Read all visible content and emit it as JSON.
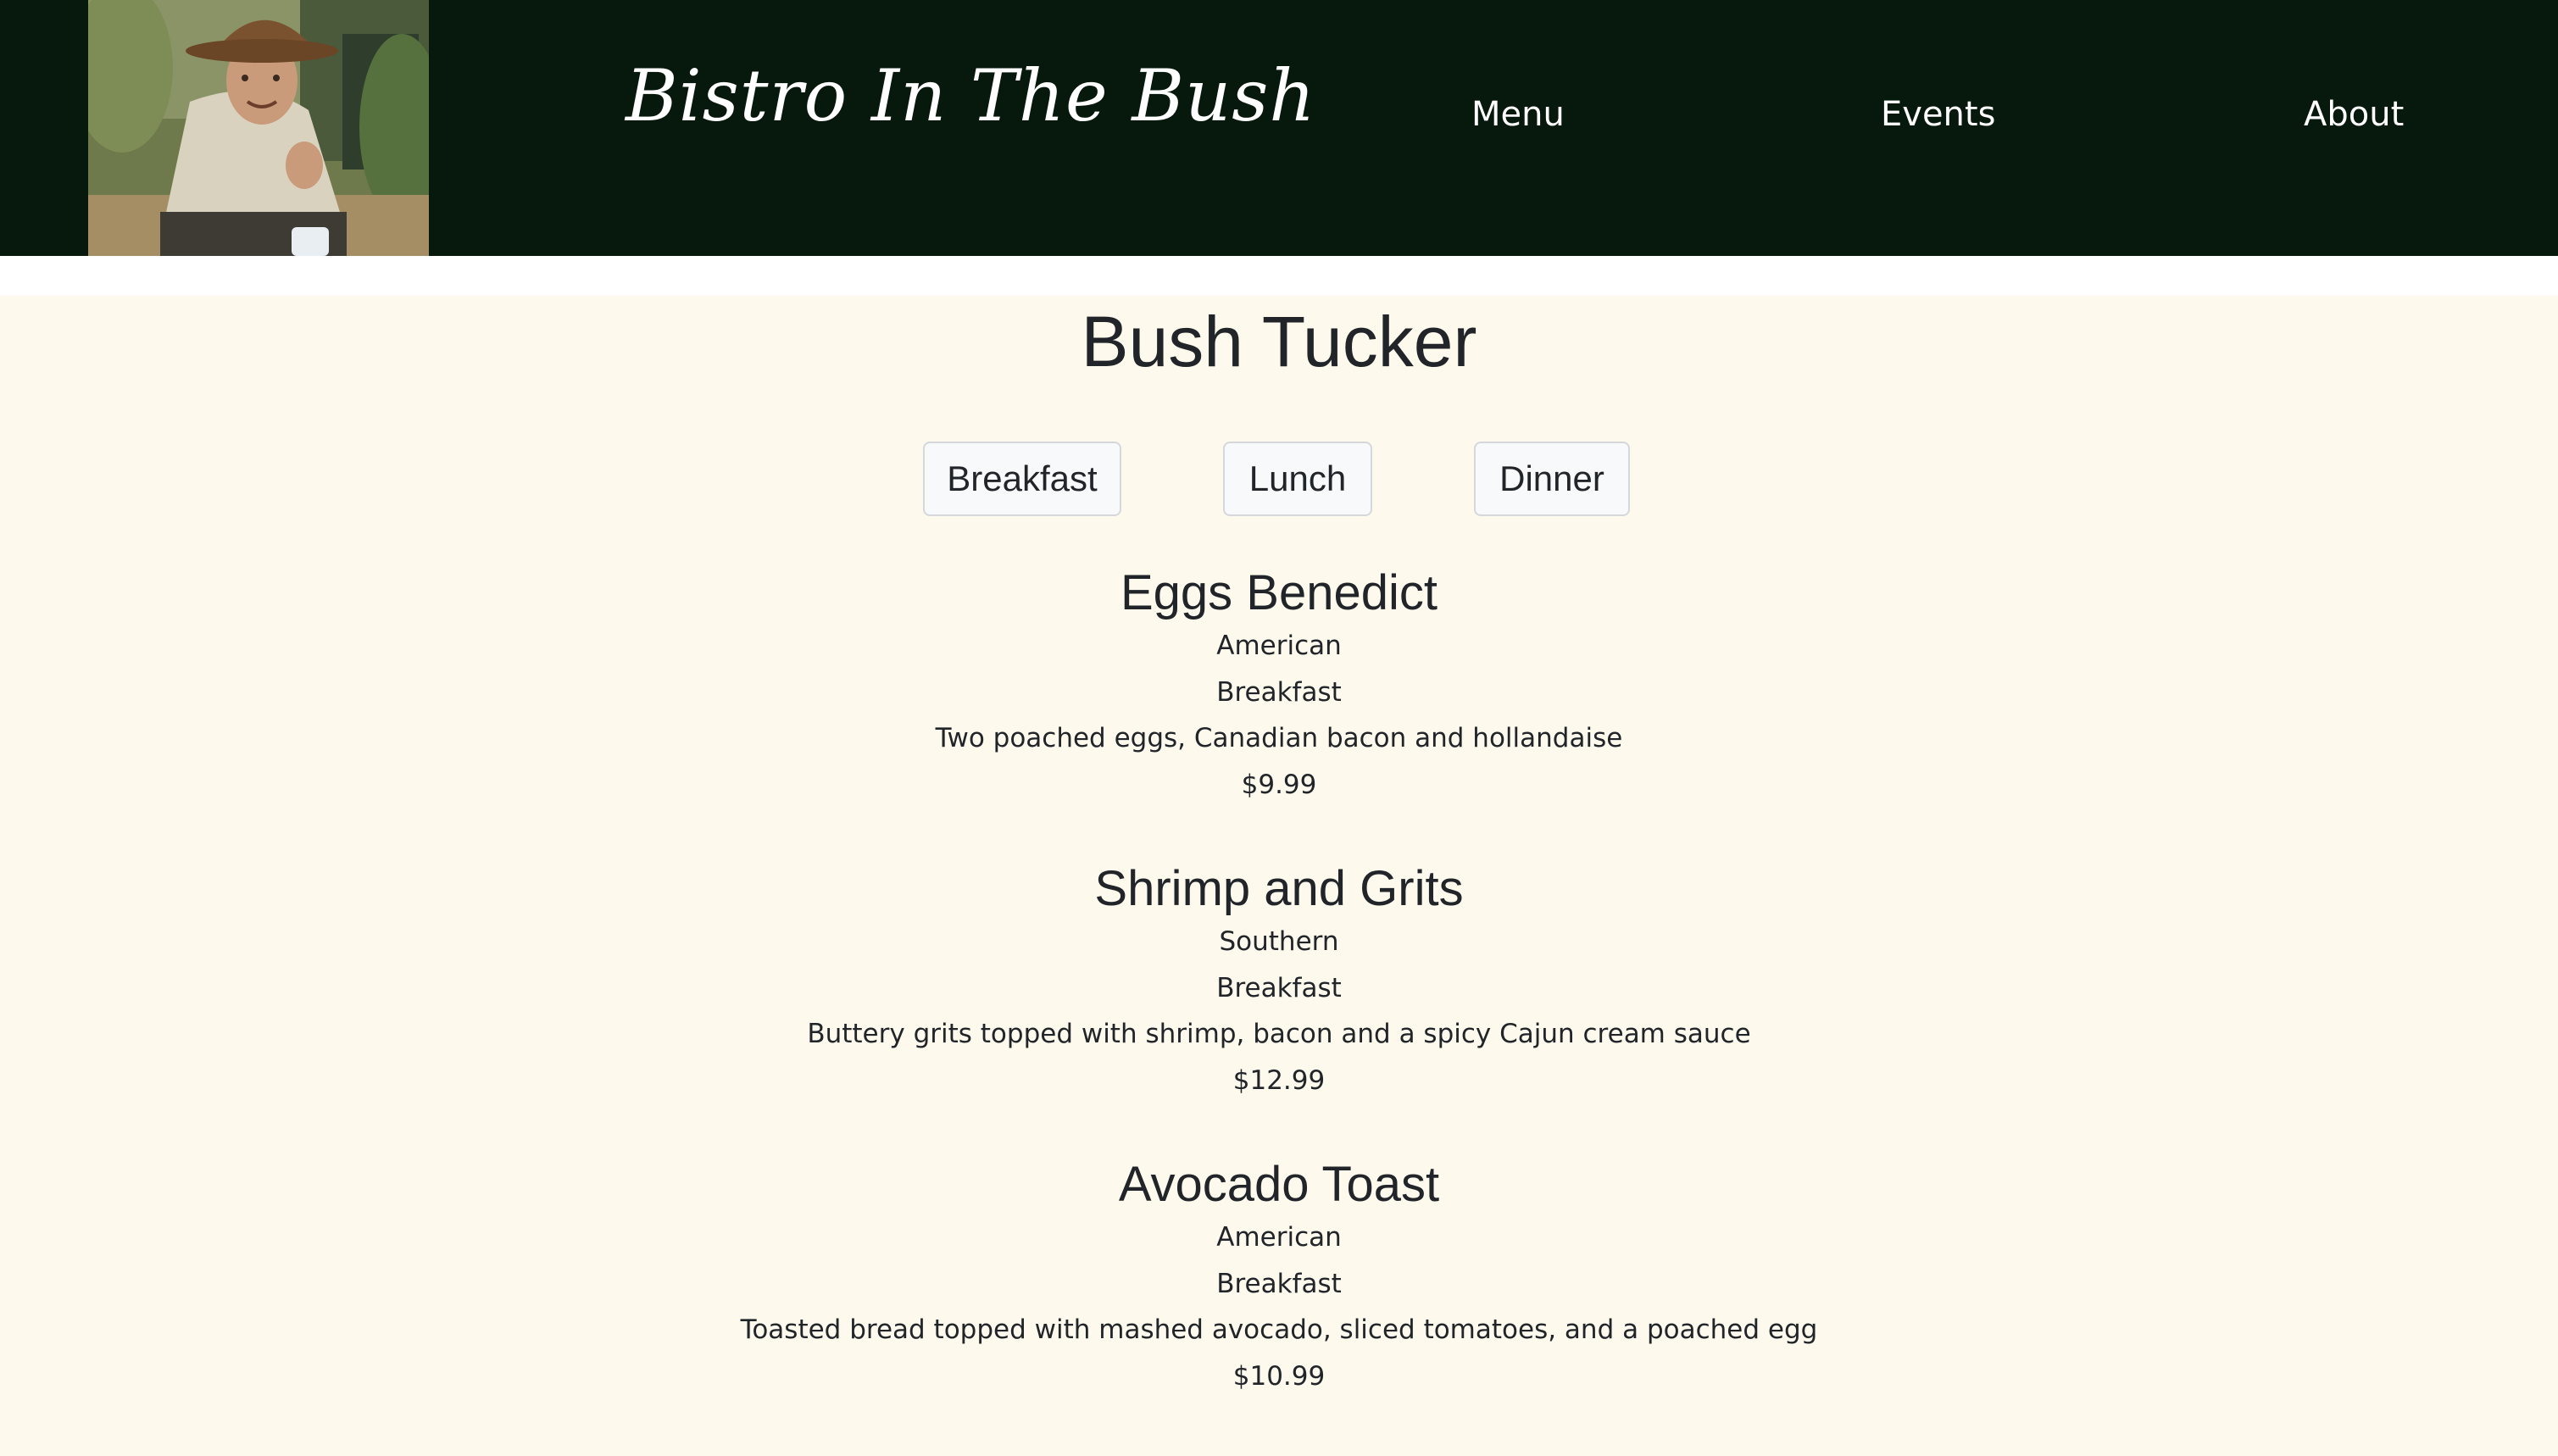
{
  "header": {
    "brand": "Bistro In The Bush",
    "nav": [
      {
        "label": "Menu"
      },
      {
        "label": "Events"
      },
      {
        "label": "About"
      }
    ]
  },
  "main": {
    "title": "Bush Tucker",
    "filters": [
      {
        "label": "Breakfast"
      },
      {
        "label": "Lunch"
      },
      {
        "label": "Dinner"
      }
    ],
    "items": [
      {
        "name": "Eggs Benedict",
        "cuisine": "American",
        "meal": "Breakfast",
        "description": "Two poached eggs, Canadian bacon and hollandaise",
        "price": "$9.99"
      },
      {
        "name": "Shrimp and Grits",
        "cuisine": "Southern",
        "meal": "Breakfast",
        "description": "Buttery grits topped with shrimp, bacon and a spicy Cajun cream sauce",
        "price": "$12.99"
      },
      {
        "name": "Avocado Toast",
        "cuisine": "American",
        "meal": "Breakfast",
        "description": "Toasted bread topped with mashed avocado, sliced tomatoes, and a poached egg",
        "price": "$10.99"
      }
    ]
  },
  "colors": {
    "navbar_bg": "#06190c",
    "content_bg": "#fdfaed",
    "text": "#212529",
    "button_bg": "#f8f9fa"
  },
  "icons": {
    "hero_photo": "chef-photo"
  }
}
